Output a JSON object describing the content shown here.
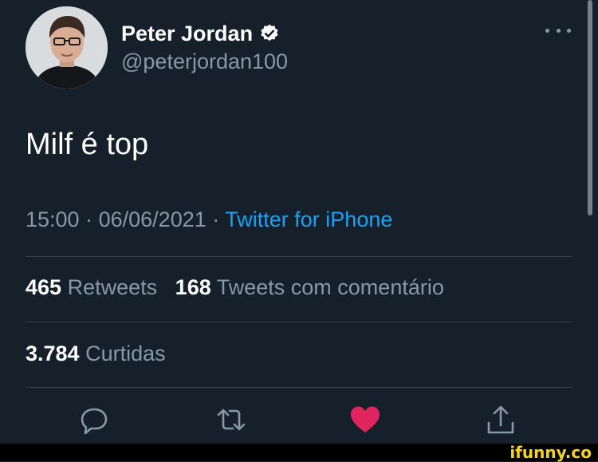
{
  "tweet": {
    "author": {
      "name": "Peter Jordan",
      "handle": "@peterjordan100",
      "verified": true
    },
    "text": "Milf é top",
    "time": "15:00",
    "separator": "·",
    "date": "06/06/2021",
    "source": "Twitter for iPhone",
    "stats": {
      "retweets_count": "465",
      "retweets_label": "Retweets",
      "quotes_count": "168",
      "quotes_label": "Tweets com comentário",
      "likes_count": "3.784",
      "likes_label": "Curtidas"
    },
    "actions": [
      "reply-icon",
      "retweet-icon",
      "heart-icon",
      "share-icon"
    ],
    "liked": true
  },
  "colors": {
    "background": "#15202b",
    "text": "#ffffff",
    "secondary": "#8899a6",
    "link": "#1da1f2",
    "like": "#e0245e",
    "divider": "#38444d"
  },
  "watermark": {
    "brand": "ifunny.co"
  }
}
